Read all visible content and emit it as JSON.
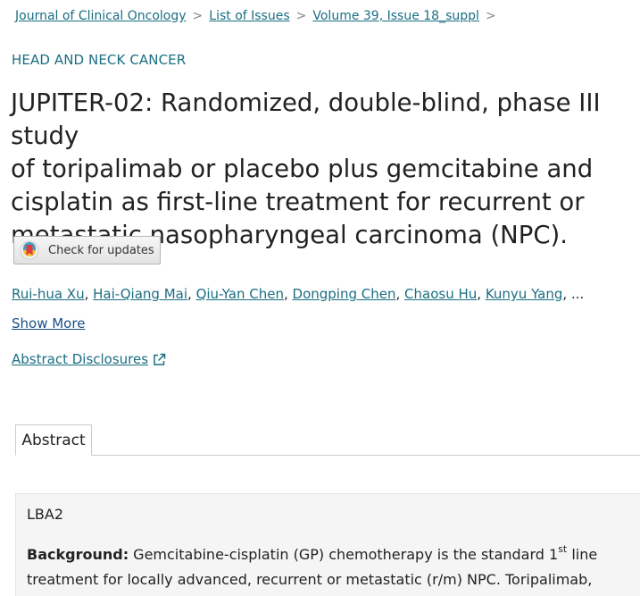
{
  "breadcrumb": {
    "items": [
      "Journal of Clinical Oncology",
      "List of Issues",
      "Volume 39, Issue 18_suppl"
    ],
    "separator": ">"
  },
  "section_label": "HEAD AND NECK CANCER",
  "article": {
    "title_lines": [
      "JUPITER-02: Randomized, double-blind, phase III study",
      "of toripalimab or placebo plus gemcitabine and",
      "cisplatin as first-line treatment for recurrent or",
      "metastatic nasopharyngeal carcinoma (NPC)."
    ]
  },
  "check_updates": {
    "label": "Check for updates",
    "icon": "crossmark-icon"
  },
  "authors": {
    "names": [
      "Rui-hua Xu",
      "Hai-Qiang Mai",
      "Qiu-Yan Chen",
      "Dongping Chen",
      "Chaosu Hu",
      "Kunyu Yang"
    ],
    "ellipsis": "..."
  },
  "show_more": "Show More",
  "disclosures": {
    "label": "Abstract Disclosures",
    "icon": "external-link-icon"
  },
  "tabs": [
    {
      "label": "Abstract",
      "active": true
    }
  ],
  "abstract": {
    "id": "LBA2",
    "background_label": "Background:",
    "line1_before": " Gemcitabine-cisplatin (GP) chemotherapy is the standard 1",
    "line1_sup": "st",
    "line1_after": " line",
    "line2": "treatment for locally advanced, recurrent or metastatic (r/m) NPC. Toripalimab,"
  },
  "colors": {
    "link": "#1a6e82",
    "show_more": "#1a4f86",
    "text": "#222222",
    "abstract_bg": "#f5f5f5"
  }
}
